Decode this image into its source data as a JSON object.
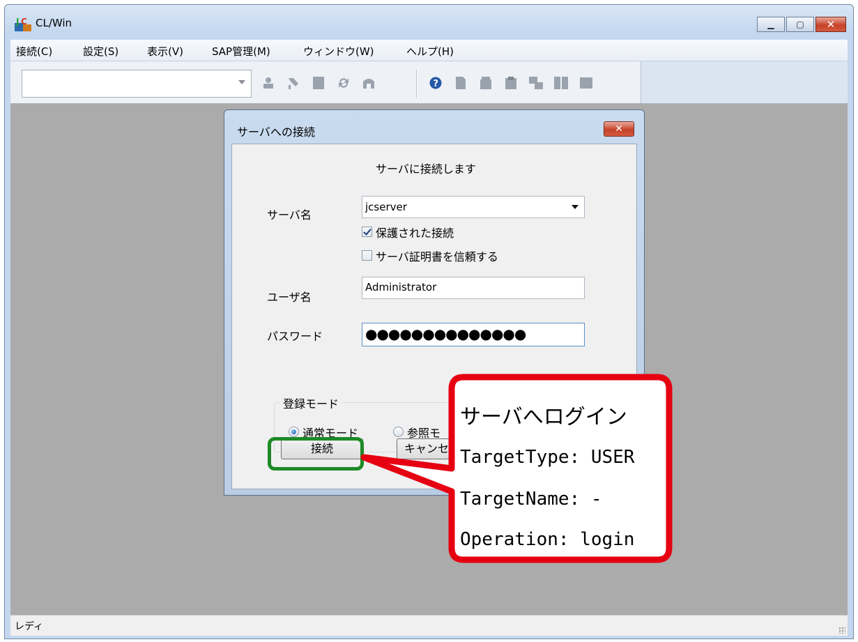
{
  "window": {
    "title": "CL/Win"
  },
  "menubar": {
    "items": [
      "接続(C)",
      "設定(S)",
      "表示(V)",
      "SAP管理(M)",
      "ウィンドウ(W)",
      "ヘルプ(H)"
    ]
  },
  "toolbar": {
    "combo_value": "",
    "icons": [
      "user-icon",
      "pin-icon",
      "document-icon",
      "refresh-icon",
      "home-icon",
      "help-icon",
      "file-icon",
      "folder-icon",
      "edit-doc-icon",
      "job-icon",
      "transfer-icon",
      "window-icon"
    ]
  },
  "dialog": {
    "title": "サーバへの接続",
    "message": "サーバに接続します",
    "server_label": "サーバ名",
    "server_value": "jcserver",
    "protected_label": "保護された接続",
    "protected_checked": true,
    "trust_label": "サーバ証明書を信頼する",
    "trust_checked": false,
    "user_label": "ユーザ名",
    "user_value": "Administrator",
    "password_label": "パスワード",
    "password_value": "●●●●●●●●●●●●●●",
    "mode_group_label": "登録モード",
    "mode_normal": "通常モード",
    "mode_reference": "参照モ",
    "connect_button": "接続",
    "cancel_button": "キャンセ"
  },
  "callout": {
    "title": "サーバへログイン",
    "line1": "TargetType: USER",
    "line2": "TargetName: -",
    "line3": "Operation: login"
  },
  "statusbar": {
    "text": "レディ"
  },
  "colors": {
    "callout_border": "#e60012",
    "focus_border": "#1e8a26",
    "client_bg": "#ababab"
  }
}
